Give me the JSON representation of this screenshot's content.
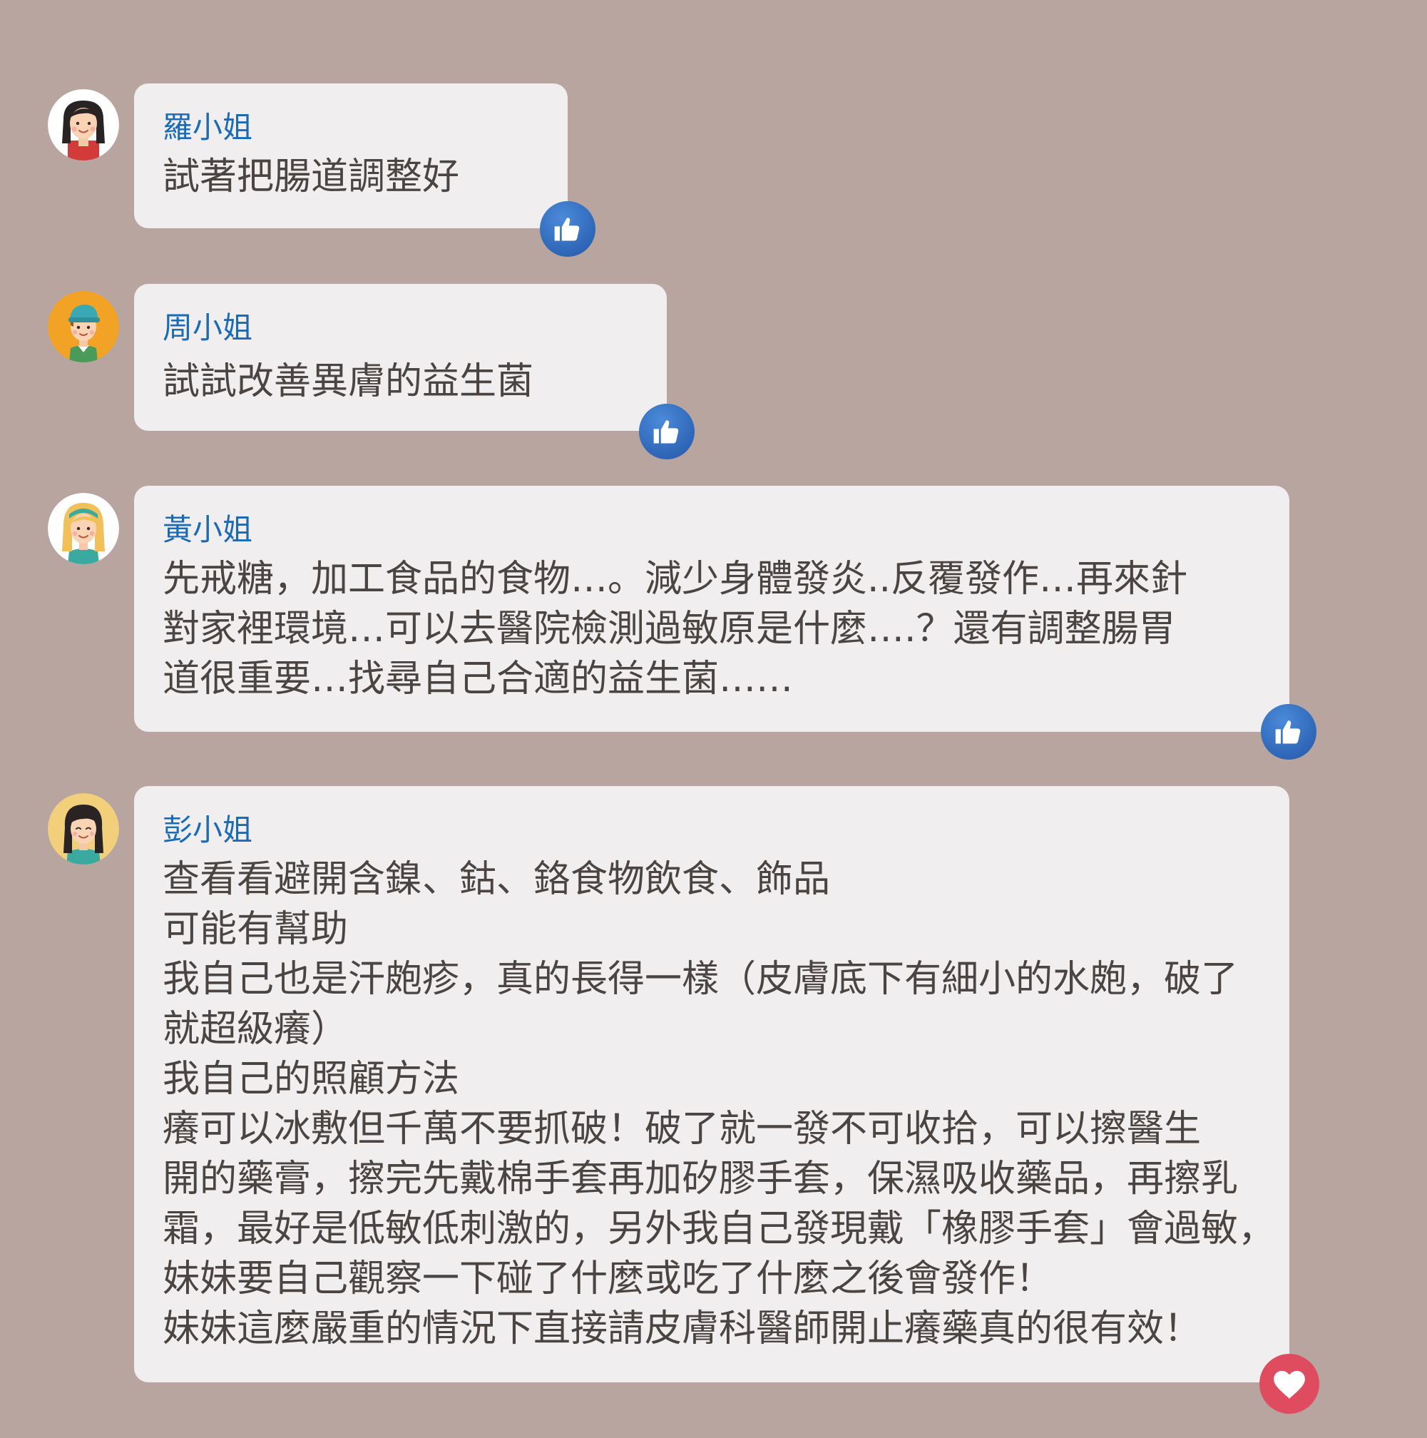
{
  "colors": {
    "background": "#b8a59f",
    "bubble": "#f0eeee",
    "name": "#1a6bb5",
    "text": "#4a4442",
    "like": "#2f66b7",
    "love": "#df4b5f"
  },
  "comments": [
    {
      "name": "羅小姐",
      "avatar": "woman-red-shirt-avatar",
      "lines": [
        "試著把腸道調整好"
      ],
      "reaction": "like-icon"
    },
    {
      "name": "周小姐",
      "avatar": "boy-cap-avatar",
      "lines": [
        "試試改善異膚的益生菌"
      ],
      "reaction": "like-icon"
    },
    {
      "name": "黃小姐",
      "avatar": "blonde-woman-avatar",
      "lines": [
        "先戒糖，加工食品的食物…。減少身體發炎..反覆發作…再來針",
        "對家裡環境…可以去醫院檢測過敏原是什麼….？還有調整腸胃",
        "道很重要…找尋自己合適的益生菌……"
      ],
      "reaction": "like-icon"
    },
    {
      "name": "彭小姐",
      "avatar": "woman-teal-shirt-avatar",
      "lines": [
        "查看看避開含鎳、鈷、鉻食物飲食、飾品",
        "可能有幫助",
        "我自己也是汗皰疹，真的長得一樣（皮膚底下有細小的水皰，破了",
        "就超級癢）",
        "我自己的照顧方法",
        "癢可以冰敷但千萬不要抓破！破了就一發不可收拾，可以擦醫生",
        "開的藥膏，擦完先戴棉手套再加矽膠手套，保濕吸收藥品，再擦乳",
        "霜，最好是低敏低刺激的，另外我自己發現戴「橡膠手套」會過敏，",
        "妹妹要自己觀察一下碰了什麼或吃了什麼之後會發作！",
        "妹妹這麼嚴重的情況下直接請皮膚科醫師開止癢藥真的很有效！"
      ],
      "reaction": "heart-icon"
    }
  ]
}
